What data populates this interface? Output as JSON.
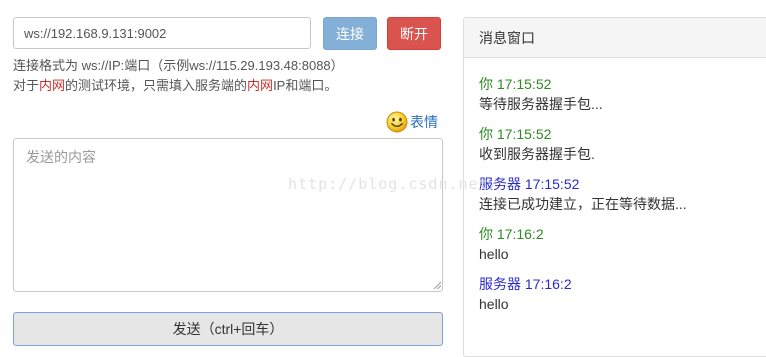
{
  "connection": {
    "url_value": "ws://192.168.9.131:9002",
    "connect_label": "连接",
    "disconnect_label": "断开"
  },
  "hints": {
    "format": "连接格式为 ws://IP:端口（示例ws://115.29.193.48:8088）",
    "line2_a": "对于",
    "line2_red1": "内网",
    "line2_b": "的测试环境，只需填入服务端的",
    "line2_red2": "内网",
    "line2_c": "IP和端口。"
  },
  "emoji": {
    "icon": "smiley-face-icon",
    "label": "表情"
  },
  "composer": {
    "placeholder": "发送的内容",
    "send_label": "发送（ctrl+回车）"
  },
  "panel": {
    "title": "消息窗口",
    "messages": [
      {
        "sender": "你",
        "time": "17:15:52",
        "text": "等待服务器握手包..."
      },
      {
        "sender": "你",
        "time": "17:15:52",
        "text": "收到服务器握手包."
      },
      {
        "sender": "服务器",
        "time": "17:15:52",
        "text": "连接已成功建立，正在等待数据..."
      },
      {
        "sender": "你",
        "time": "17:16:2",
        "text": "hello"
      },
      {
        "sender": "服务器",
        "time": "17:16:2",
        "text": "hello"
      }
    ]
  },
  "watermark": "http://blog.csdn.net/",
  "colors": {
    "connect_button": "#84afd6",
    "disconnect_button": "#d9534f",
    "self_sender": "#2e8b22",
    "server_sender": "#2b2bc8",
    "highlight": "#c9302c"
  }
}
